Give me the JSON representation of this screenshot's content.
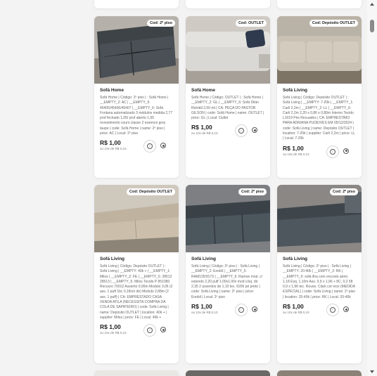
{
  "colors": {
    "background": "#f3f3f4",
    "card": "#ffffff",
    "text": "#222222"
  },
  "cards": [
    {
      "badge": "Cod: 2º piso",
      "title": "Sofá Home",
      "desc": "Sofá Home | Código: 2º piso | : Sofá Home | __EMPTY_2: AC | __EMPTY_5: 45405/45406/45407 | __EMPTY_6: Sofá Fontana automatizado 3 módulos medida 2,77 prof fechado 1,05/ prof aberto 1,65 revestimento couro classe 2 essence grey taupe | code: Sofá Home | name: 2º piso | price: AC | Local: 2º piso",
      "price": "R$ 1,00",
      "installments": "ou 10x de R$ 0,10"
    },
    {
      "badge": "Cod: OUTLET",
      "title": "Sofá Home",
      "desc": "Sofá Home | Código: OUTLET | : Sofá Home | __EMPTY_2: GL | __EMPTY_6: Sofá Dilan Retrátil 2,50 mt | CA: PEÇA DO PASTOR GILSON | code: Sofá Home | name: OUTLET | price: GL | Local: Outlet",
      "price": "R$ 1,00",
      "installments": "ou 10x de R$ 0,10"
    },
    {
      "badge": "Cod: Depósito OUTLET",
      "title": "Sofá Living",
      "desc": "Sofá Living | Código: Depósito OUTLET | : Sofá Living | __EMPTY: 7-20k | __EMPTY_1: Carli 2,2m | __EMPTY_2: LL | __EMPTY_6: Carli 2,2m 2,20 x 0,86 x 0,80m Interno Tecido L1019 Pés Recuados | CA: EMPRESTIMO PARA ADRIANA PUDEIVES EM 05/12/2024 | code: Sofá Living | name: Depósito OUTLET | location: 7-20k | supplier: Carli 2,2m | price: LL | Local: 7-20k",
      "price": "R$ 1,00",
      "installments": "ou 10x de R$ 0,10"
    },
    {
      "badge": "Cod: Depósito OUTLET",
      "title": "Sofá Living",
      "desc": "Sofá Living | Código: Depósito OUTLET | : Sofá Living | __EMPTY: 40k + | __EMPTY_1: Milos | __EMPTY_2: FE | __EMPTY_5: 28512 28513 | __EMPTY_6: Milos Tecido P 851080 Recouro 70012 Assento 0,96m Modulo 3,06 (2 ass. 1 puff 1bc 0,18cm dir) Modulo 2,88m (2 ass. 1 puff) | CA: EMPRESTADO CASA VENDA ATILA (NECESSITA COMPRA DA COLA DE SAPATEIRO) | code: Sofá Living | name: Depósito OUTLET | location: 40k + | supplier: Milos | price: FE | Local: 40k +",
      "price": "R$ 1,00",
      "installments": "ou 10x de R$ 0,10"
    },
    {
      "badge": "Cod: 2º piso",
      "title": "Sofá Living",
      "desc": "Sofá Living | Código: 2º piso | : Sofá Living | __EMPTY_2: Enobil | __EMPTY_5: RAM135/9173 | __EMPTY_6: Ramon mod. c/ estendo 2,20 puff 1,00x1,00x mod c/sq. dir 2,35 2 assentos de 1,10 tec. 6200 pé preto | code: Sofá Living | name: 2º piso | price: Enobil | Local: 2º piso",
      "price": "R$ 1,00",
      "installments": "ou 10x de R$ 0,10"
    },
    {
      "badge": "Cod: 2º piso",
      "title": "Sofá Living",
      "desc": "Sofá Living | Código: 2º piso | : Sofá Living | __EMPTY: 20-40k | __EMPTY_2: RK | __EMPTY_6: sofá ilha com encosto atom. 1,18 Esq. 1,10m Ass. 0,9 x 1,96 + 8C, 0,2 58 0,9 x 1,96 tec. Rouxe. Clark cor inox (MEDIDA ESPECIAL) | code: Sofá Living | name: 2º piso | location: 20-40k | price: RK | Local: 20-40k",
      "price": "R$ 1,00",
      "installments": "ou 10x de R$ 0,10"
    }
  ]
}
